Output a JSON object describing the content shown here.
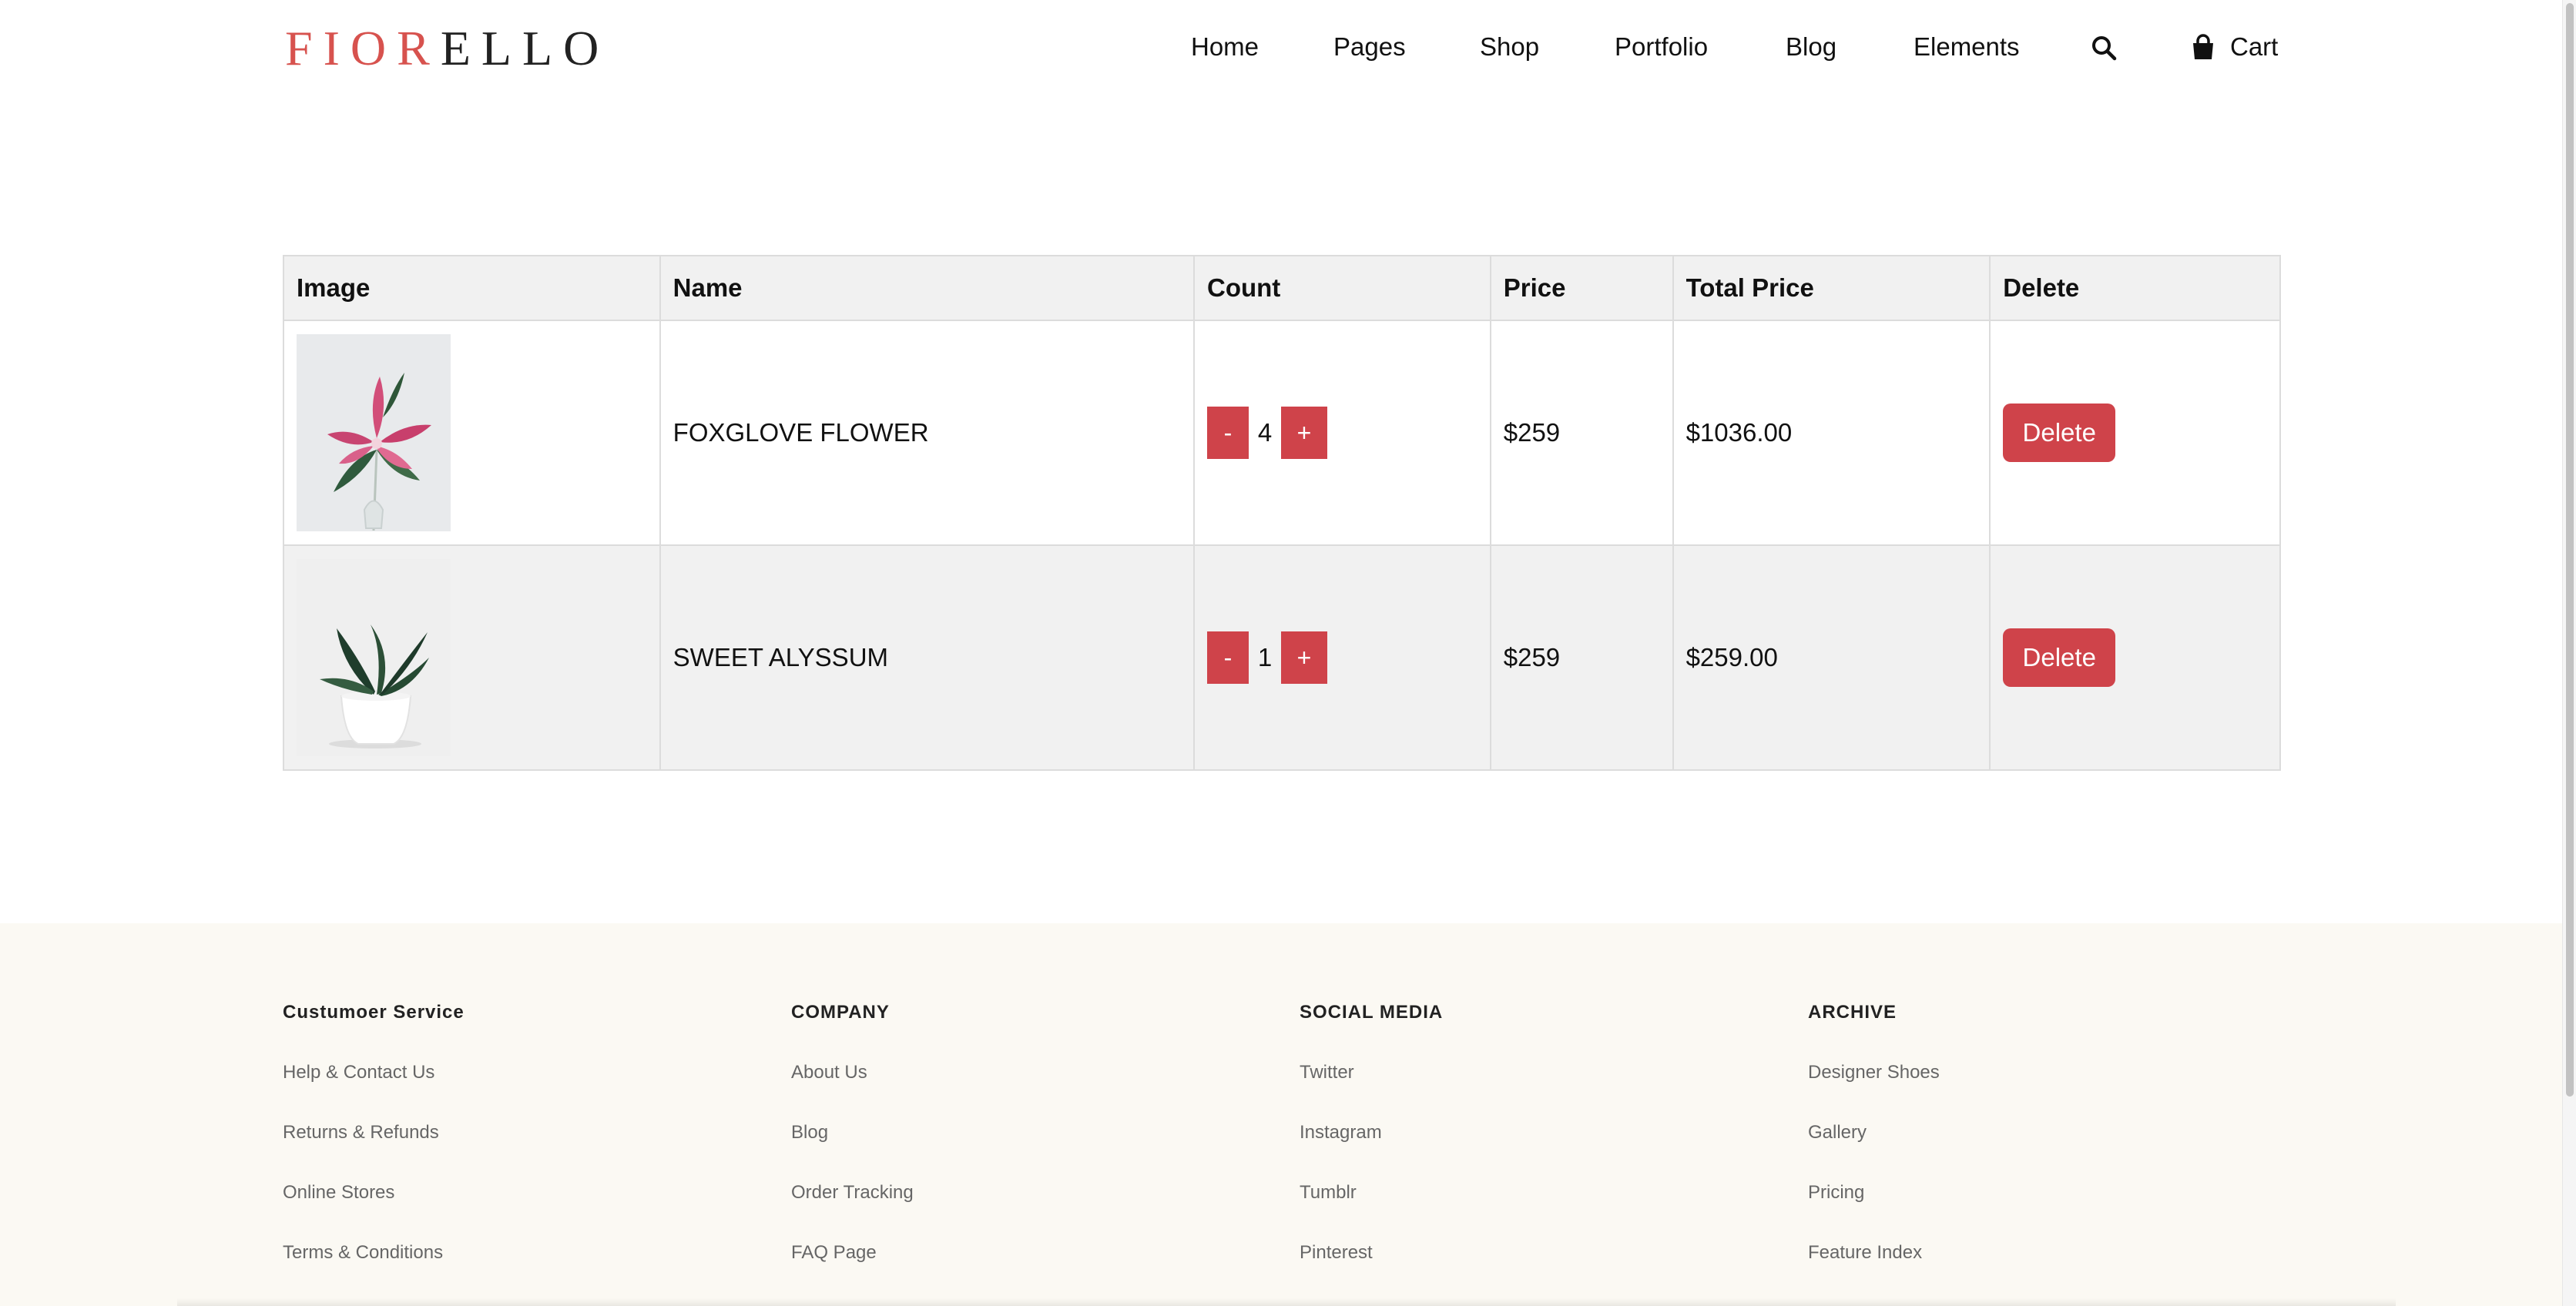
{
  "header": {
    "logo_part1": "FIOR",
    "logo_part2": "ELLO",
    "nav": [
      "Home",
      "Pages",
      "Shop",
      "Portfolio",
      "Blog",
      "Elements"
    ],
    "search_icon": "search-icon",
    "cart_icon": "shopping-bag-icon",
    "cart_label": "Cart"
  },
  "cart": {
    "headers": [
      "Image",
      "Name",
      "Count",
      "Price",
      "Total Price",
      "Delete"
    ],
    "rows": [
      {
        "name": "FOXGLOVE FLOWER",
        "count": "4",
        "price": "$259",
        "total": "$1036.00",
        "minus": "-",
        "plus": "+",
        "delete_label": "Delete"
      },
      {
        "name": "SWEET ALYSSUM",
        "count": "1",
        "price": "$259",
        "total": "$259.00",
        "minus": "-",
        "plus": "+",
        "delete_label": "Delete"
      }
    ]
  },
  "footer": {
    "columns": [
      {
        "title": "Custumoer Service",
        "links": [
          "Help & Contact Us",
          "Returns & Refunds",
          "Online Stores",
          "Terms & Conditions"
        ]
      },
      {
        "title": "COMPANY",
        "links": [
          "About Us",
          "Blog",
          "Order Tracking",
          "FAQ Page"
        ]
      },
      {
        "title": "SOCIAL MEDIA",
        "links": [
          "Twitter",
          "Instagram",
          "Tumblr",
          "Pinterest"
        ]
      },
      {
        "title": "ARCHIVE",
        "links": [
          "Designer Shoes",
          "Gallery",
          "Pricing",
          "Feature Index"
        ]
      }
    ]
  },
  "colors": {
    "accent": "#cf434a",
    "logo_red": "#d7524e",
    "footer_bg": "#fbf9f3",
    "table_header_bg": "#f1f1f1"
  }
}
